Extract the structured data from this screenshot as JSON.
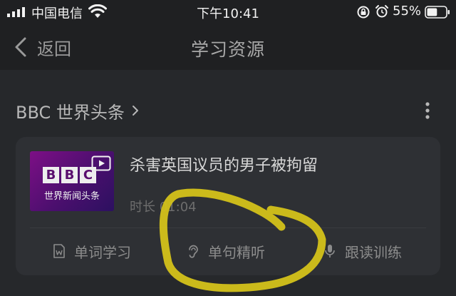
{
  "status_bar": {
    "carrier": "中国电信",
    "time": "下午10:41",
    "battery_percent": "55%",
    "battery_level": 0.55
  },
  "nav": {
    "back_label": "返回",
    "title": "学习资源"
  },
  "section": {
    "title": "BBC 世界头条"
  },
  "card": {
    "thumbnail": {
      "logo_letters": [
        "B",
        "B",
        "C"
      ],
      "caption": "世界新闻头条"
    },
    "title": "杀害英国议员的男子被拘留",
    "duration": "时长 01:04",
    "actions": {
      "vocab": "单词学习",
      "sentence": "单句精听",
      "shadow": "跟读训练"
    }
  },
  "colors": {
    "background": "#26282b",
    "card": "#2e3034",
    "annotation": "#d4c21a"
  }
}
